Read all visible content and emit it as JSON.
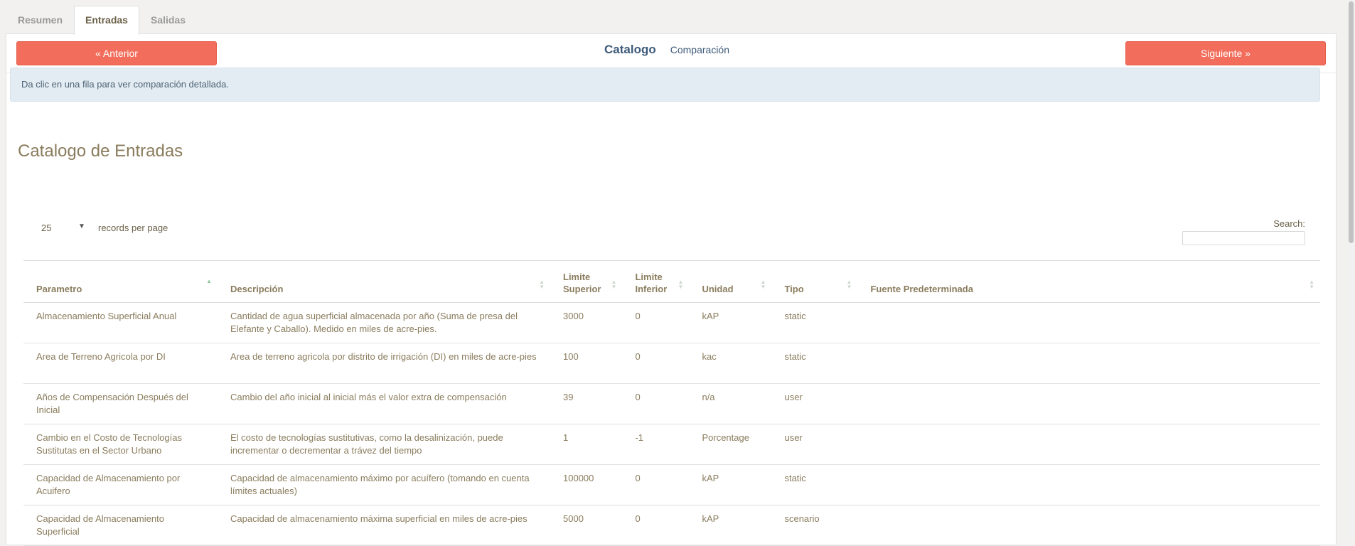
{
  "tabs": [
    {
      "label": "Resumen",
      "active": false
    },
    {
      "label": "Entradas",
      "active": true
    },
    {
      "label": "Salidas",
      "active": false
    }
  ],
  "nav": {
    "prev_label": "« Anterior",
    "next_label": "Siguiente »",
    "catalog_label": "Catalogo",
    "compare_label": "Comparación"
  },
  "alert": {
    "text": "Da clic en una fila para ver comparación detallada."
  },
  "section": {
    "title": "Catalogo de Entradas"
  },
  "length_menu": {
    "value": "25",
    "label": "records per page"
  },
  "search": {
    "label": "Search:",
    "value": "",
    "placeholder": ""
  },
  "table": {
    "headers": {
      "parametro": "Parametro",
      "descripcion": "Descripción",
      "sup_1": "Limite",
      "sup_2": "Superior",
      "inf_1": "Limite",
      "inf_2": "Inferior",
      "unidad": "Unidad",
      "tipo": "Tipo",
      "fuente": "Fuente Predeterminada"
    },
    "rows": [
      {
        "parametro": "Almacenamiento Superficial Anual",
        "descripcion": "Cantidad de agua superficial almacenada por año (Suma de presa del Elefante y Caballo). Medido en miles de acre-pies.",
        "superior": "3000",
        "inferior": "0",
        "unidad": "kAP",
        "tipo": "static",
        "fuente": ""
      },
      {
        "parametro": "Area de Terreno Agricola por DI",
        "descripcion": "Area de terreno agricola por distrito de irrigación (DI) en miles de acre-pies",
        "superior": "100",
        "inferior": "0",
        "unidad": "kac",
        "tipo": "static",
        "fuente": ""
      },
      {
        "parametro": "Años de Compensación Después del Inicial",
        "descripcion": "Cambio del año inicial al inicial más el valor extra de compensación",
        "superior": "39",
        "inferior": "0",
        "unidad": "n/a",
        "tipo": "user",
        "fuente": ""
      },
      {
        "parametro": "Cambio en el Costo de Tecnologías Sustitutas en el Sector Urbano",
        "descripcion": "El costo de tecnologías sustitutivas, como la desalinización, puede incrementar o decrementar a trávez del tiempo",
        "superior": "1",
        "inferior": "-1",
        "unidad": "Porcentage",
        "tipo": "user",
        "fuente": ""
      },
      {
        "parametro": "Capacidad de Almacenamiento por Acuifero",
        "descripcion": "Capacidad de almacenamiento máximo por acuífero (tomando en cuenta límites actuales)",
        "superior": "100000",
        "inferior": "0",
        "unidad": "kAP",
        "tipo": "static",
        "fuente": ""
      },
      {
        "parametro": "Capacidad de Almacenamiento Superficial",
        "descripcion": "Capacidad de almacenamiento máxima superficial en miles de acre-pies",
        "superior": "5000",
        "inferior": "0",
        "unidad": "kAP",
        "tipo": "scenario",
        "fuente": ""
      }
    ]
  }
}
